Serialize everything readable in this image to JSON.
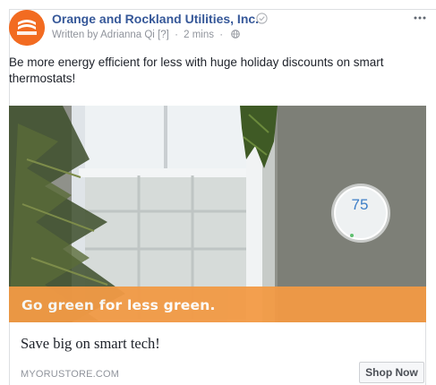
{
  "post": {
    "page_name": "Orange and Rockland Utilities, Inc.",
    "byline_prefix": "Written by",
    "author": "Adrianna Qi",
    "help_marker": "[?]",
    "time": "2 mins",
    "text": "Be more energy efficient for less with huge holiday discounts on smart thermostats!"
  },
  "ad": {
    "banner_text": "Go green for less green.",
    "thermostat_value": "75",
    "headline": "Save big on smart tech!",
    "domain": "MYORUSTORE.COM",
    "cta_label": "Shop Now"
  },
  "icons": {
    "avatar": "orange-rockland-logo",
    "verified": "check-circle-icon",
    "privacy": "globe-icon",
    "menu": "more-options-icon"
  },
  "colors": {
    "brand_orange": "#f26b21",
    "banner_orange": "#f29a45",
    "link_blue": "#365899",
    "muted_gray": "#90949c"
  }
}
